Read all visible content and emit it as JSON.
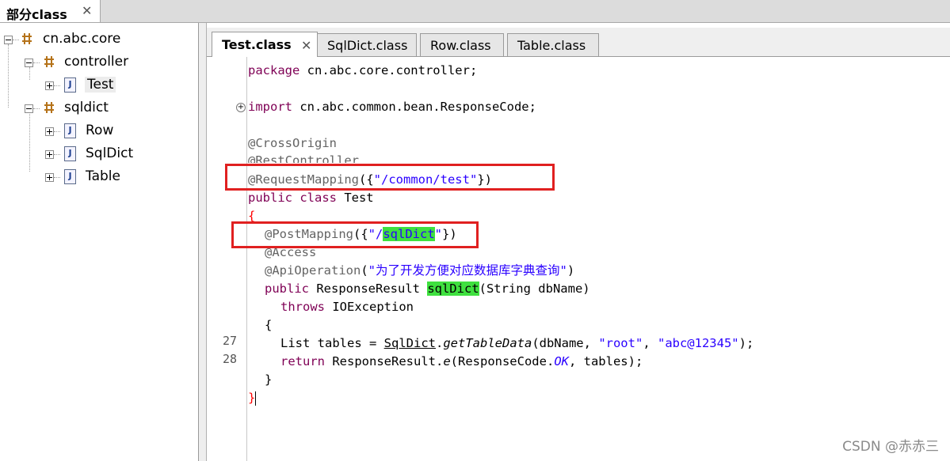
{
  "panel": {
    "tab_label": "部分class",
    "close": "✕"
  },
  "tree": {
    "root": "cn.abc.core",
    "controller": "controller",
    "test": "Test",
    "sqldict": "sqldict",
    "row": "Row",
    "sqldict_class": "SqlDict",
    "table": "Table"
  },
  "editor_tabs": [
    {
      "label": "Test.class",
      "active": true,
      "close": "✕"
    },
    {
      "label": "SqlDict.class"
    },
    {
      "label": "Row.class"
    },
    {
      "label": "Table.class"
    }
  ],
  "code": {
    "l1_kw": "package",
    "l1_rest": " cn.abc.core.controller;",
    "l2_kw": "import",
    "l2_rest": " cn.abc.common.bean.ResponseCode;",
    "l3": "@CrossOrigin",
    "l4": "@RestController",
    "l5_ann": "@RequestMapping",
    "l5_pre": "({",
    "l5_str": "\"/common/test\"",
    "l5_post": "})",
    "l6_kw": "public class",
    "l6_rest": " Test",
    "l7": "{",
    "l8_ann": "@PostMapping",
    "l8_pre": "({",
    "l8_str1": "\"/",
    "l8_hl": "sqlDict",
    "l8_str2": "\"",
    "l8_post": "})",
    "l9": "@Access",
    "l10_ann": "@ApiOperation",
    "l10_pre": "(",
    "l10_str": "\"为了开发方便对应数据库字典查询\"",
    "l10_post": ")",
    "l11_kw": "public",
    "l11_mid": " ResponseResult ",
    "l11_hl": "sqlDict",
    "l11_post": "(String dbName)",
    "l12_kw": "throws",
    "l12_rest": " IOException",
    "l13": "{",
    "l14_a": "List tables = ",
    "l14_cls": "SqlDict",
    "l14_dot": ".",
    "l14_m": "getTableData",
    "l14_b": "(dbName, ",
    "l14_s1": "\"root\"",
    "l14_c": ", ",
    "l14_s2": "\"abc@12345\"",
    "l14_d": ");",
    "l15_kw": "return",
    "l15_a": " ResponseResult.",
    "l15_m": "e",
    "l15_b": "(ResponseCode.",
    "l15_c": "OK",
    "l15_d": ", tables);",
    "l16": "}",
    "l17": "}"
  },
  "line_numbers": {
    "n27": "27",
    "n28": "28"
  },
  "fold_marker": "+",
  "watermark": "CSDN @赤赤三"
}
